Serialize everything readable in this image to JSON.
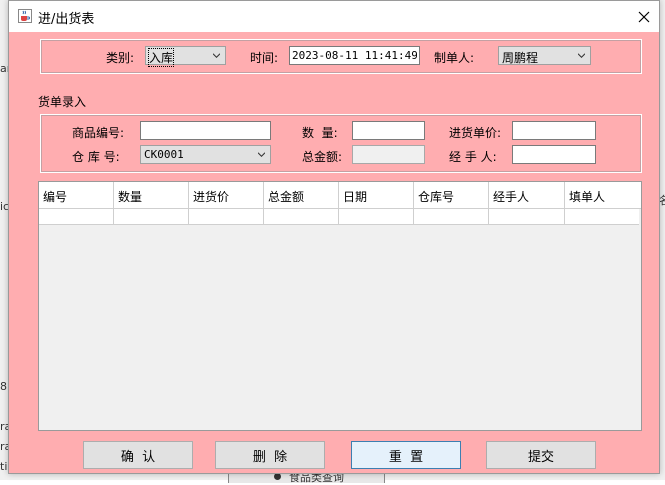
{
  "window": {
    "title": "进/出货表"
  },
  "background": {
    "left_fragments": [
      "ar",
      "ic",
      "8",
      "",
      "ra",
      "ra",
      "ti"
    ],
    "right_fragment": "名",
    "bottom_item": "食品类查询"
  },
  "header": {
    "category_label": "类别:",
    "category_value": "入库",
    "time_label": "时间:",
    "time_value": "2023-08-11 11:41:49",
    "creator_label": "制单人:",
    "creator_value": "周鹏程"
  },
  "entry": {
    "section_title": "货单录入",
    "product_no_label": "商品编号:",
    "product_no_value": "",
    "quantity_label": "数  量:",
    "quantity_value": "",
    "unit_price_label": "进货单价:",
    "unit_price_value": "",
    "warehouse_label": "仓 库 号:",
    "warehouse_value": "CK0001",
    "total_label": "总金额:",
    "total_value": "",
    "handler_label": "经 手 人:",
    "handler_value": ""
  },
  "table": {
    "columns": [
      "编号",
      "数量",
      "进货价",
      "总金额",
      "日期",
      "仓库号",
      "经手人",
      "填单人"
    ],
    "rows": [
      [
        "",
        "",
        "",
        "",
        "",
        "",
        "",
        ""
      ]
    ]
  },
  "buttons": {
    "confirm": "确  认",
    "delete": "删  除",
    "reset": "重  置",
    "submit": "提交"
  }
}
